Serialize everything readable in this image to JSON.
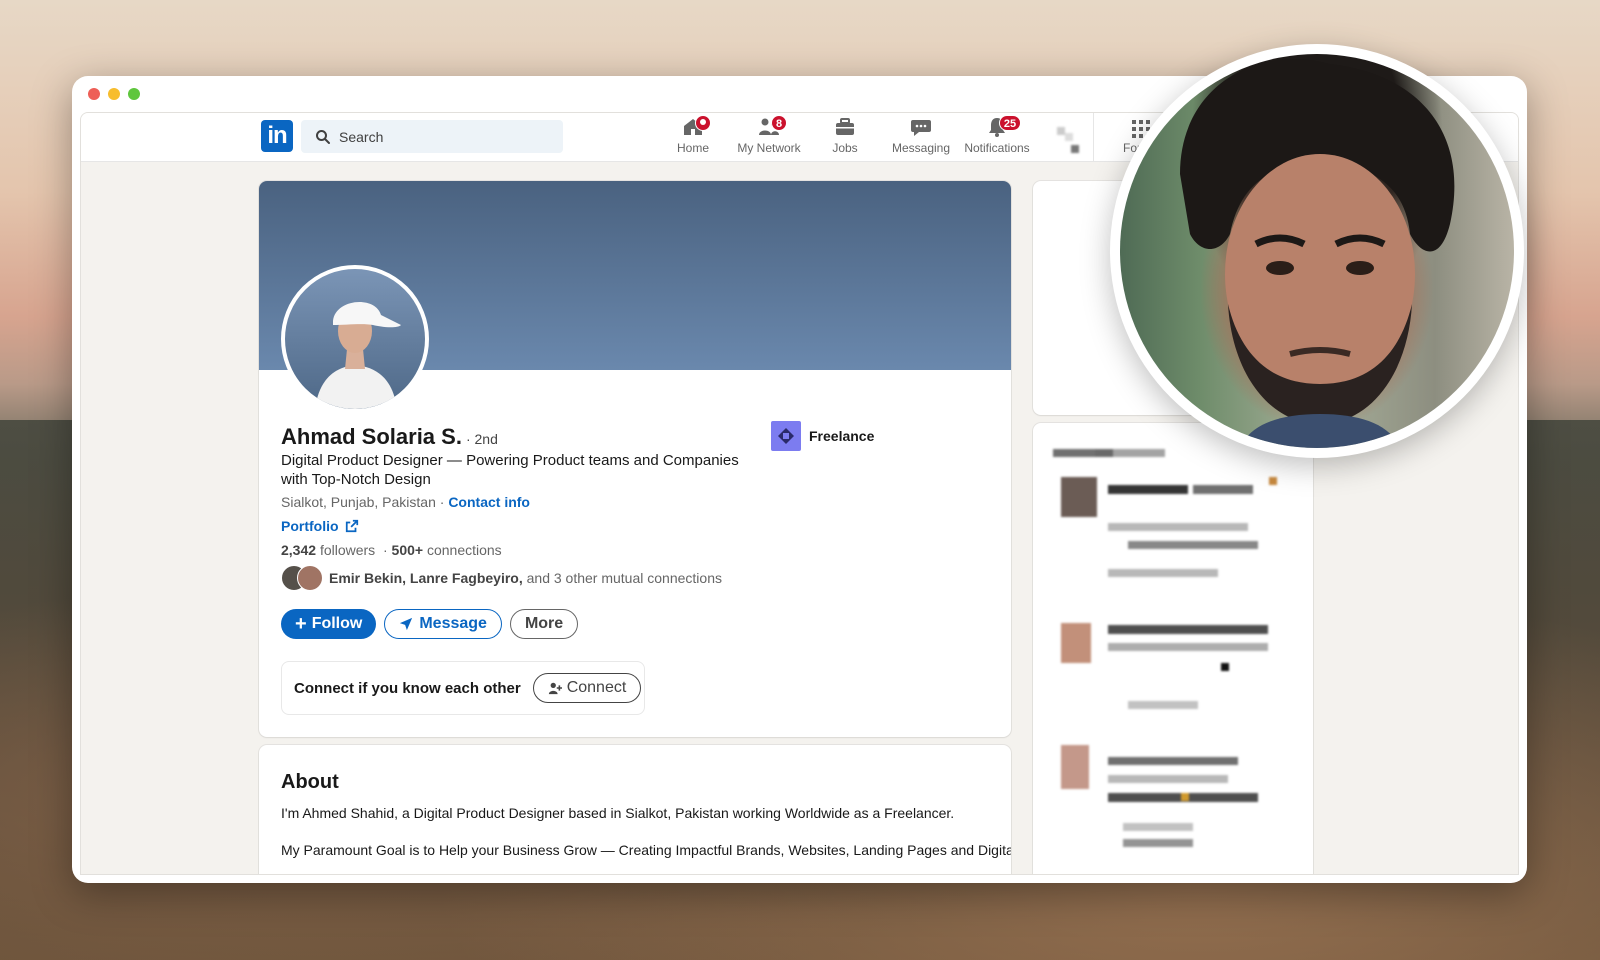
{
  "nav": {
    "search_placeholder": "Search",
    "items": [
      {
        "label": "Home",
        "badge": "",
        "icon": "home-icon"
      },
      {
        "label": "My Network",
        "badge": "8",
        "icon": "network-icon"
      },
      {
        "label": "Jobs",
        "badge": "",
        "icon": "briefcase-icon"
      },
      {
        "label": "Messaging",
        "badge": "",
        "icon": "messaging-icon"
      },
      {
        "label": "Notifications",
        "badge": "25",
        "icon": "bell-icon"
      }
    ],
    "for_business": "For Bu"
  },
  "profile": {
    "name": "Ahmad Solaria S.",
    "degree": "· 2nd",
    "headline": "Digital Product Designer — Powering Product teams and Companies with Top-Notch Design",
    "location": "Sialkot, Punjab, Pakistan ·",
    "contact_info": "Contact info",
    "portfolio": "Portfolio",
    "followers": "2,342",
    "followers_label": "followers",
    "connections": "500+",
    "connections_label": "connections",
    "mutual_names": "Emir Bekin, Lanre Fagbeyiro,",
    "mutual_rest": "and 3 other mutual connections",
    "follow": "Follow",
    "message": "Message",
    "more": "More",
    "connect_prompt": "Connect if you know each other",
    "connect": "Connect",
    "company": "Freelance"
  },
  "about": {
    "title": "About",
    "p1": "I'm Ahmed Shahid, a Digital Product Designer based in Sialkot, Pakistan working Worldwide as a Freelancer.",
    "p2": "My Paramount Goal is to Help your Business Grow — Creating Impactful Brands, Websites, Landing Pages and Digital"
  },
  "colors": {
    "brand": "#0a66c2",
    "badge": "#cb112d",
    "cover": "#5b7699",
    "company_logo": "#7c7cf0"
  }
}
